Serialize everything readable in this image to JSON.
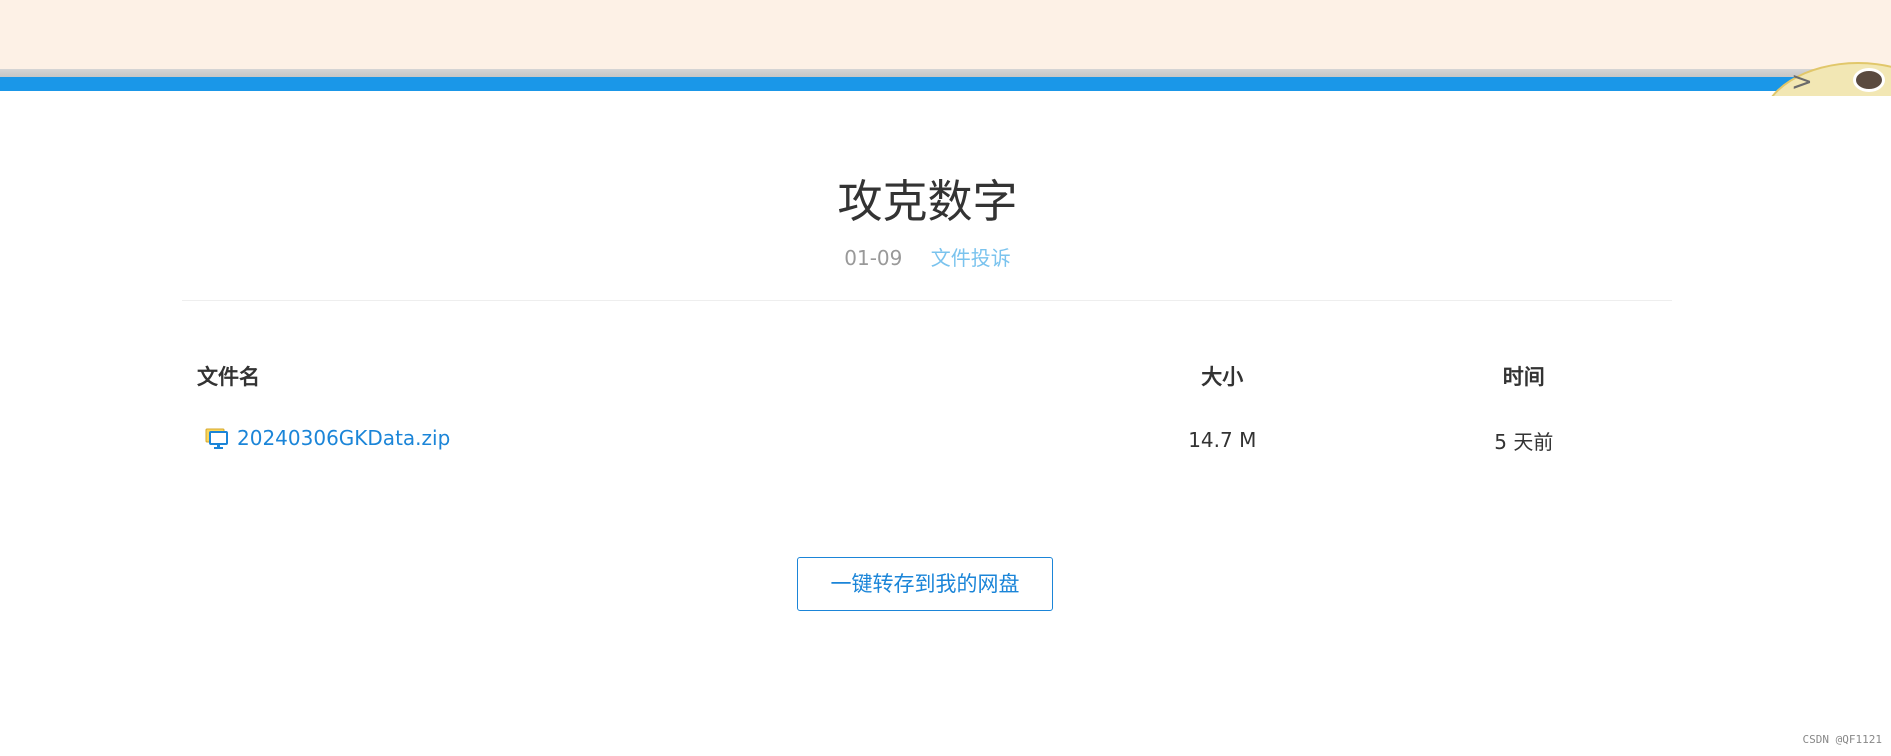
{
  "header": {
    "title": "攻克数字",
    "date": "01-09",
    "report_link": "文件投诉"
  },
  "table": {
    "columns": [
      "文件名",
      "大小",
      "时间"
    ],
    "rows": [
      {
        "name": "20240306GKData.zip",
        "size": "14.7 M",
        "time": "5 天前"
      }
    ]
  },
  "actions": {
    "save_label": "一键转存到我的网盘"
  },
  "watermark": "CSDN @QF1121",
  "colors": {
    "accent": "#1b85d8",
    "top_bar": "#fdf1e6",
    "blue_strip": "#1a97e8",
    "report_link": "#7ac3ee"
  },
  "icons": {
    "file": "monitor-file-icon",
    "mascot": "mascot-face-icon"
  }
}
